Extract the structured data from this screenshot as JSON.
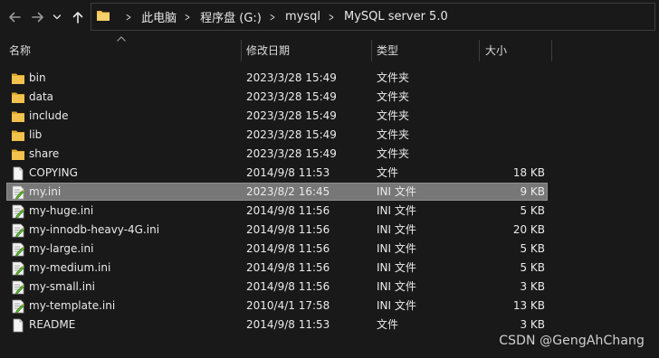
{
  "nav": {
    "back_icon": "arrow-left-icon",
    "forward_icon": "arrow-right-icon",
    "recent_icon": "chevron-down-icon",
    "up_icon": "arrow-up-icon"
  },
  "address": {
    "crumbs": [
      "此电脑",
      "程序盘 (G:)",
      "mysql",
      "MySQL server 5.0"
    ]
  },
  "columns": {
    "name": "名称",
    "date": "修改日期",
    "type": "类型",
    "size": "大小"
  },
  "files": [
    {
      "name": "bin",
      "date": "2023/3/28 15:49",
      "type": "文件夹",
      "size": "",
      "icon": "folder-icon"
    },
    {
      "name": "data",
      "date": "2023/3/28 15:49",
      "type": "文件夹",
      "size": "",
      "icon": "folder-icon"
    },
    {
      "name": "include",
      "date": "2023/3/28 15:49",
      "type": "文件夹",
      "size": "",
      "icon": "folder-icon"
    },
    {
      "name": "lib",
      "date": "2023/3/28 15:49",
      "type": "文件夹",
      "size": "",
      "icon": "folder-icon"
    },
    {
      "name": "share",
      "date": "2023/3/28 15:49",
      "type": "文件夹",
      "size": "",
      "icon": "folder-icon"
    },
    {
      "name": "COPYING",
      "date": "2014/9/8 11:53",
      "type": "文件",
      "size": "18 KB",
      "icon": "file-icon"
    },
    {
      "name": "my.ini",
      "date": "2023/8/2 16:45",
      "type": "INI 文件",
      "size": "9 KB",
      "icon": "ini-file-icon",
      "selected": true
    },
    {
      "name": "my-huge.ini",
      "date": "2014/9/8 11:56",
      "type": "INI 文件",
      "size": "5 KB",
      "icon": "ini-file-icon"
    },
    {
      "name": "my-innodb-heavy-4G.ini",
      "date": "2014/9/8 11:56",
      "type": "INI 文件",
      "size": "20 KB",
      "icon": "ini-file-icon"
    },
    {
      "name": "my-large.ini",
      "date": "2014/9/8 11:56",
      "type": "INI 文件",
      "size": "5 KB",
      "icon": "ini-file-icon"
    },
    {
      "name": "my-medium.ini",
      "date": "2014/9/8 11:56",
      "type": "INI 文件",
      "size": "5 KB",
      "icon": "ini-file-icon"
    },
    {
      "name": "my-small.ini",
      "date": "2014/9/8 11:56",
      "type": "INI 文件",
      "size": "3 KB",
      "icon": "ini-file-icon"
    },
    {
      "name": "my-template.ini",
      "date": "2010/4/1 17:58",
      "type": "INI 文件",
      "size": "13 KB",
      "icon": "ini-file-icon"
    },
    {
      "name": "README",
      "date": "2014/9/8 11:53",
      "type": "文件",
      "size": "3 KB",
      "icon": "file-icon"
    }
  ],
  "watermark": "CSDN @GengAhChang",
  "colors": {
    "background": "#191919",
    "folder": "#f2c14e",
    "selection": "#777777"
  }
}
